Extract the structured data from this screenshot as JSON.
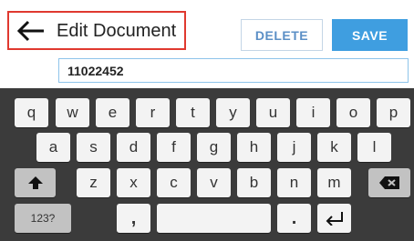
{
  "header": {
    "title": "Edit Document",
    "delete_label": "DELETE",
    "save_label": "SAVE",
    "back_icon": "arrow-left-icon",
    "highlight_color": "#e0392f",
    "accent_color": "#3f9ee0"
  },
  "document": {
    "value": "11022452"
  },
  "keyboard": {
    "row1": [
      "q",
      "w",
      "e",
      "r",
      "t",
      "y",
      "u",
      "i",
      "o",
      "p"
    ],
    "row2": [
      "a",
      "s",
      "d",
      "f",
      "g",
      "h",
      "j",
      "k",
      "l"
    ],
    "row3": [
      "z",
      "x",
      "c",
      "v",
      "b",
      "n",
      "m"
    ],
    "symbols_label": "123?",
    "comma_label": ",",
    "period_label": ".",
    "shift_icon": "shift-arrow-icon",
    "backspace_icon": "backspace-icon",
    "enter_icon": "enter-icon"
  }
}
